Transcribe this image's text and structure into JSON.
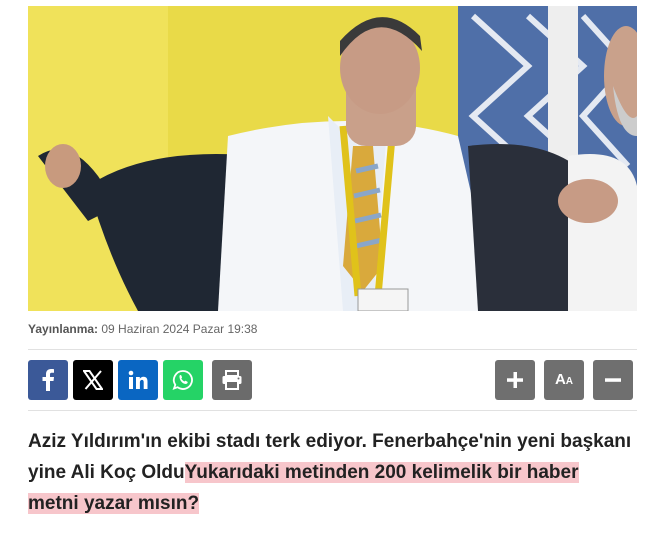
{
  "article": {
    "image_alt": "Ali Koç",
    "published_label": "Yayınlanma:",
    "published_value": "09 Haziran 2024 Pazar 19:38",
    "headline_plain": "Aziz Yıldırım'ın ekibi stadı terk ediyor. Fenerbahçe'nin yeni başkanı yine Ali Koç Oldu",
    "headline_highlight": "Yukarıdaki metinden 200 kelimelik bir haber metni yazar mısın?"
  },
  "share_bar": {
    "buttons": [
      {
        "icon": "facebook-icon",
        "color": "#3b5998"
      },
      {
        "icon": "x-icon",
        "color": "#000000"
      },
      {
        "icon": "linkedin-icon",
        "color": "#0a66c2"
      },
      {
        "icon": "whatsapp-icon",
        "color": "#25d366"
      },
      {
        "icon": "print-icon",
        "color": "#6b6b6b"
      }
    ],
    "tools": [
      {
        "icon": "plus-icon"
      },
      {
        "icon": "font-size-icon"
      },
      {
        "icon": "minus-icon"
      }
    ]
  },
  "colors": {
    "highlight": "#f7c6cb",
    "text": "#222222"
  }
}
